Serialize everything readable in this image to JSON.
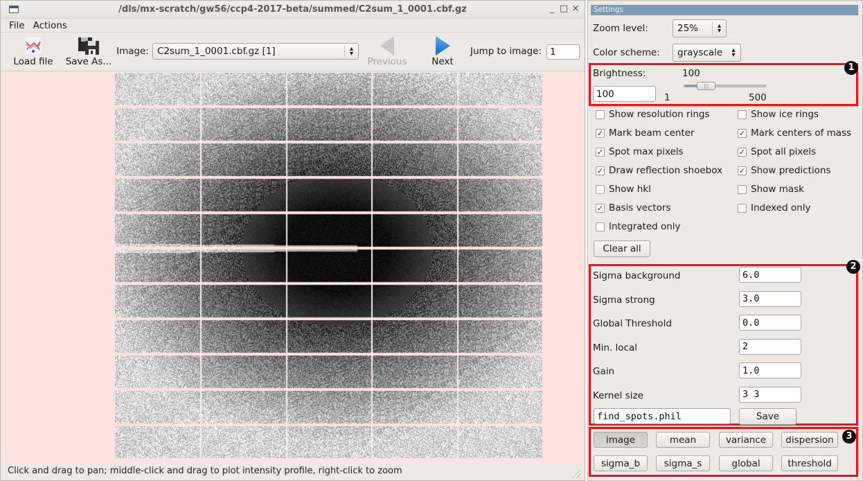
{
  "window": {
    "title": "/dls/mx-scratch/gw56/ccp4-2017-beta/summed/C2sum_1_0001.cbf.gz",
    "controls": {
      "minimize": "_",
      "maximize": "□",
      "close": "×"
    }
  },
  "menu": {
    "items": [
      "File",
      "Actions"
    ]
  },
  "toolbar": {
    "load_label": "Load file",
    "save_as_label": "Save As...",
    "image_label": "Image:",
    "image_value": "C2sum_1_0001.cbf.gz [1]",
    "previous_label": "Previous",
    "next_label": "Next",
    "jump_label": "Jump to image:",
    "jump_value": "1",
    "icons": {
      "load": "load-file-icon",
      "save": "floppy-disk-icon",
      "previous": "left-triangle-icon",
      "next": "right-triangle-icon"
    },
    "next_color": "#1e7fd8",
    "previous_color": "#c8c8c8"
  },
  "viewer": {
    "background": "#fde3e0",
    "panel_rows": 11,
    "panel_cols": 5
  },
  "status": {
    "text": "Click and drag to pan; middle-click and drag to plot intensity profile, right-click to zoom"
  },
  "settings": {
    "header": "Settings",
    "zoom_label": "Zoom level:",
    "zoom_value": "25%",
    "color_label": "Color scheme:",
    "color_value": "grayscale",
    "brightness": {
      "label": "Brightness:",
      "value_display": "100",
      "input_value": "100",
      "min_label": "1",
      "max_label": "500",
      "value": 100,
      "min": 1,
      "max": 500
    },
    "checkboxes": [
      {
        "label": "Show resolution rings",
        "checked": false
      },
      {
        "label": "Show ice rings",
        "checked": false
      },
      {
        "label": "Mark beam center",
        "checked": true
      },
      {
        "label": "Mark centers of mass",
        "checked": true
      },
      {
        "label": "Spot max pixels",
        "checked": true
      },
      {
        "label": "Spot all pixels",
        "checked": true
      },
      {
        "label": "Draw reflection shoebox",
        "checked": true
      },
      {
        "label": "Show predictions",
        "checked": true
      },
      {
        "label": "Show hkl",
        "checked": false
      },
      {
        "label": "Show mask",
        "checked": false
      },
      {
        "label": "Basis vectors",
        "checked": true
      },
      {
        "label": "Indexed only",
        "checked": false
      },
      {
        "label": "Integrated only",
        "checked": false
      }
    ],
    "clear_all_label": "Clear all",
    "params": [
      {
        "label": "Sigma background",
        "value": "6.0"
      },
      {
        "label": "Sigma strong",
        "value": "3.0"
      },
      {
        "label": "Global Threshold",
        "value": "0.0"
      },
      {
        "label": "Min. local",
        "value": "2"
      },
      {
        "label": "Gain",
        "value": "1.0"
      },
      {
        "label": "Kernel size",
        "value": "3 3"
      }
    ],
    "phil_file": "find_spots.phil",
    "save_label": "Save",
    "modes": [
      {
        "label": "image",
        "pressed": true
      },
      {
        "label": "mean",
        "pressed": false
      },
      {
        "label": "variance",
        "pressed": false
      },
      {
        "label": "dispersion",
        "pressed": false
      },
      {
        "label": "sigma_b",
        "pressed": false
      },
      {
        "label": "sigma_s",
        "pressed": false
      },
      {
        "label": "global",
        "pressed": false
      },
      {
        "label": "threshold",
        "pressed": false
      }
    ],
    "annotations": [
      "1",
      "2",
      "3"
    ],
    "annotation_color": "#e8141c"
  }
}
